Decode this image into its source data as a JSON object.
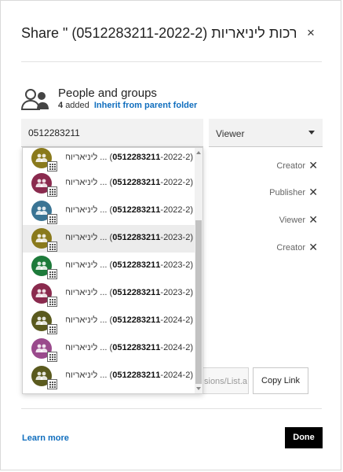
{
  "dialog": {
    "title": "Share \" (0512283211-2022-2) רכות ליניאריות...",
    "close_label": "×"
  },
  "people_groups": {
    "title": "People and groups",
    "added_count": "4",
    "added_label": "added",
    "inherit_link": "Inherit from parent folder",
    "icon": "people-icon"
  },
  "search": {
    "value": "0512283211",
    "placeholder": ""
  },
  "role_select": {
    "selected": "Viewer"
  },
  "permissions": [
    {
      "role": "Creator"
    },
    {
      "role": "Publisher"
    },
    {
      "role": "Viewer"
    },
    {
      "role": "Creator"
    }
  ],
  "remove_label": "✕",
  "share_url": {
    "value": "sions/List.a"
  },
  "copy_link_label": "Copy Link",
  "learn_more_label": "Learn more",
  "done_label": "Done",
  "suggestions": [
    {
      "code": "0512283211",
      "suffix": "-2022-2)",
      "name": "... ליניאריות (2",
      "prefix": "(",
      "color": "#8a7a1c",
      "highlighted": false
    },
    {
      "code": "0512283211",
      "suffix": "-2022-2)",
      "name": "... ליניאריות (2",
      "prefix": "(",
      "color": "#8a2a4e",
      "highlighted": false
    },
    {
      "code": "0512283211",
      "suffix": "-2022-2)",
      "name": "... ליניאריות (2",
      "prefix": "(",
      "color": "#3a7494",
      "highlighted": false
    },
    {
      "code": "0512283211",
      "suffix": "-2023-2)",
      "name": "... ליניאריות (2",
      "prefix": "(",
      "color": "#8a7a1c",
      "highlighted": true
    },
    {
      "code": "0512283211",
      "suffix": "-2023-2)",
      "name": "... ליניאריות (2",
      "prefix": "(",
      "color": "#1d7a3a",
      "highlighted": false
    },
    {
      "code": "0512283211",
      "suffix": "-2023-2)",
      "name": "... ליניאריות (2",
      "prefix": "(",
      "color": "#8a2a4e",
      "highlighted": false
    },
    {
      "code": "0512283211",
      "suffix": "-2024-2)",
      "name": "... ליניאריות (2",
      "prefix": "(",
      "color": "#5a5a1e",
      "highlighted": false
    },
    {
      "code": "0512283211",
      "suffix": "-2024-2)",
      "name": "... ליניאריות (2",
      "prefix": "(",
      "color": "#9a4a8c",
      "highlighted": false
    },
    {
      "code": "0512283211",
      "suffix": "-2024-2)",
      "name": "... ליניאריות (2",
      "prefix": "(",
      "color": "#5a5a1e",
      "highlighted": false
    }
  ]
}
